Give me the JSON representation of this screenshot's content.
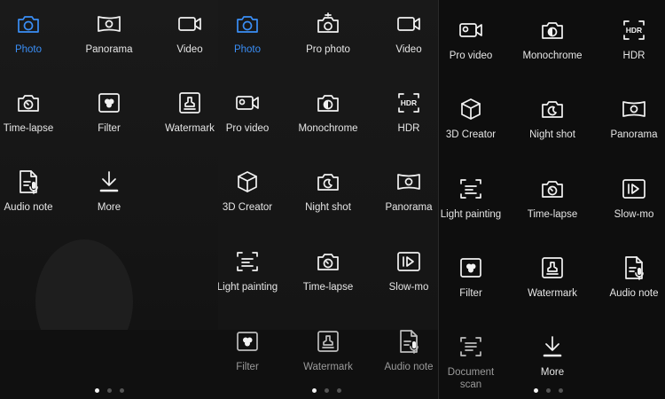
{
  "panels": [
    {
      "modes": [
        {
          "icon": "camera-icon",
          "label": "Photo",
          "active": true
        },
        {
          "icon": "panorama-icon",
          "label": "Panorama"
        },
        {
          "icon": "video-camera-icon",
          "label": "Video"
        },
        {
          "icon": "timelapse-icon",
          "label": "Time-lapse"
        },
        {
          "icon": "filter-icon",
          "label": "Filter"
        },
        {
          "icon": "watermark-icon",
          "label": "Watermark"
        },
        {
          "icon": "audio-note-icon",
          "label": "Audio note"
        },
        {
          "icon": "download-icon",
          "label": "More"
        }
      ],
      "page_index": 0
    },
    {
      "modes": [
        {
          "icon": "camera-icon",
          "label": "Photo",
          "active": true
        },
        {
          "icon": "pro-photo-icon",
          "label": "Pro photo"
        },
        {
          "icon": "video-camera-icon",
          "label": "Video"
        },
        {
          "icon": "pro-video-icon",
          "label": "Pro video"
        },
        {
          "icon": "monochrome-icon",
          "label": "Monochrome"
        },
        {
          "icon": "hdr-icon",
          "label": "HDR"
        },
        {
          "icon": "cube-3d-icon",
          "label": "3D Creator"
        },
        {
          "icon": "night-shot-icon",
          "label": "Night shot"
        },
        {
          "icon": "panorama-icon",
          "label": "Panorama"
        },
        {
          "icon": "light-painting-icon",
          "label": "Light painting"
        },
        {
          "icon": "timelapse-icon",
          "label": "Time-lapse"
        },
        {
          "icon": "slow-mo-icon",
          "label": "Slow-mo"
        },
        {
          "icon": "filter-icon",
          "label": "Filter",
          "dim": true
        },
        {
          "icon": "watermark-icon",
          "label": "Watermark",
          "dim": true
        },
        {
          "icon": "audio-note-icon",
          "label": "Audio note",
          "dim": true
        }
      ],
      "page_index": 0
    },
    {
      "modes": [
        {
          "icon": "pro-video-icon",
          "label": "Pro video"
        },
        {
          "icon": "monochrome-icon",
          "label": "Monochrome"
        },
        {
          "icon": "hdr-icon",
          "label": "HDR"
        },
        {
          "icon": "cube-3d-icon",
          "label": "3D Creator"
        },
        {
          "icon": "night-shot-icon",
          "label": "Night shot"
        },
        {
          "icon": "panorama-icon",
          "label": "Panorama"
        },
        {
          "icon": "light-painting-icon",
          "label": "Light painting"
        },
        {
          "icon": "timelapse-icon",
          "label": "Time-lapse"
        },
        {
          "icon": "slow-mo-icon",
          "label": "Slow-mo"
        },
        {
          "icon": "filter-icon",
          "label": "Filter"
        },
        {
          "icon": "watermark-icon",
          "label": "Watermark"
        },
        {
          "icon": "audio-note-icon",
          "label": "Audio note"
        },
        {
          "icon": "document-scan-icon",
          "label": "Document scan",
          "dim": true
        },
        {
          "icon": "download-icon",
          "label": "More"
        }
      ],
      "page_index": 0
    }
  ],
  "hdr_text": "HDR",
  "colors": {
    "active": "#3a8ef6",
    "text": "#e6e6e6",
    "dim": "#9a9a9a"
  }
}
